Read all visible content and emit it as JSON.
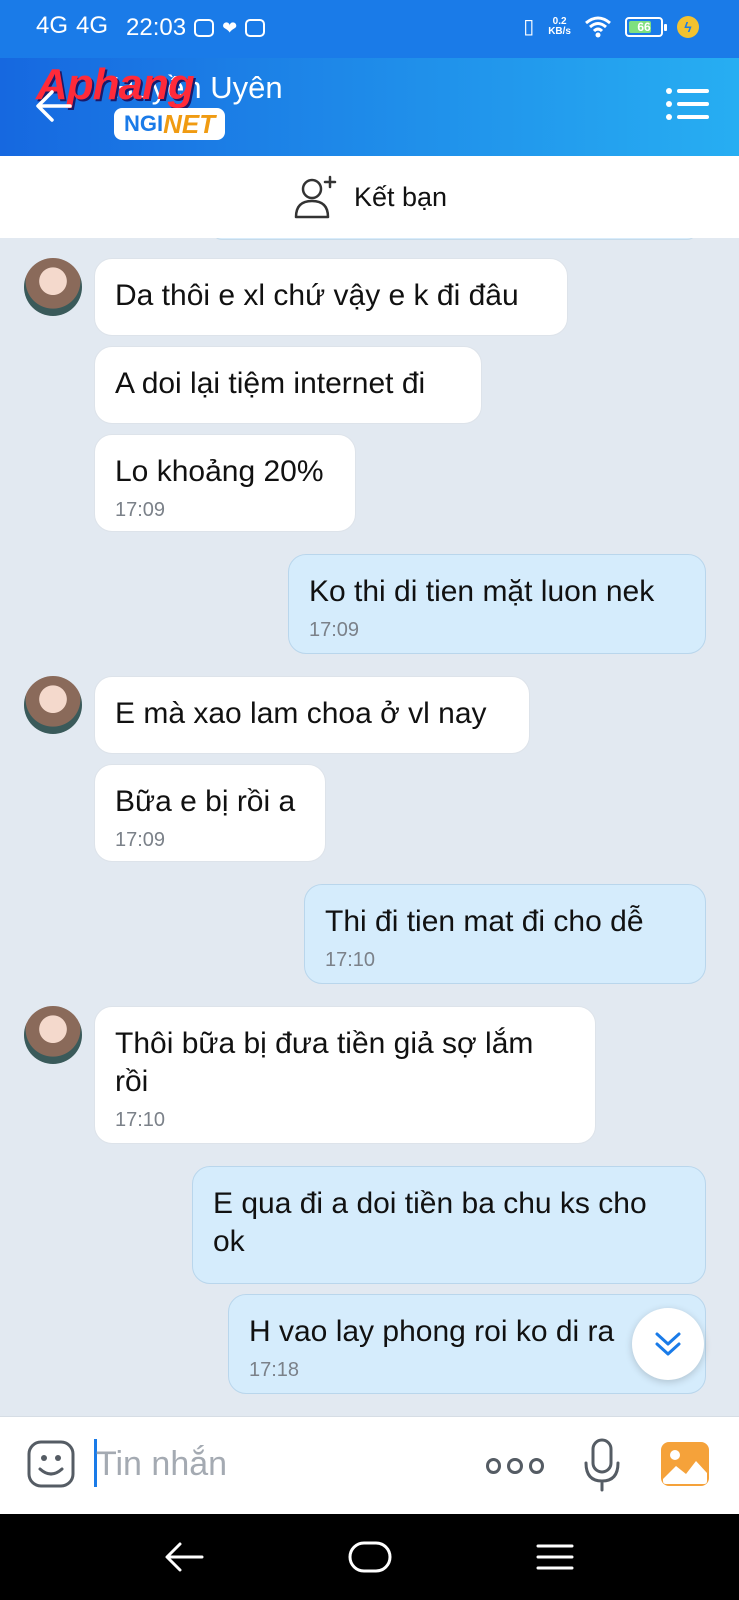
{
  "status_bar": {
    "network_1": "4G",
    "network_2": "4G",
    "time": "22:03",
    "speed_value": "0.2",
    "speed_unit": "KB/s",
    "battery": "66"
  },
  "header": {
    "contact_name": "Huyền Uyên",
    "watermark_text": "Aphang NGINET"
  },
  "friend_bar": {
    "label": "Kết bạn"
  },
  "messages": [
    {
      "text": "Da thôi e xl chứ vậy e k đi đâu",
      "time": ""
    },
    {
      "text": "A doi lại tiệm internet đi",
      "time": ""
    },
    {
      "text": "Lo khoảng 20%",
      "time": "17:09"
    },
    {
      "text": "Ko thi di tien mặt luon nek",
      "time": "17:09"
    },
    {
      "text": "E mà xao lam choa ở vl nay",
      "time": ""
    },
    {
      "text": "Bữa e bị rồi a",
      "time": "17:09"
    },
    {
      "text": "Thi đi tien mat đi cho dễ",
      "time": "17:10"
    },
    {
      "text": "Thôi bữa bị đưa tiền giả sợ lắm rồi",
      "time": "17:10"
    },
    {
      "text": "E qua đi a doi tiền ba chu ks cho ok",
      "time": ""
    },
    {
      "text": "H vao lay phong roi ko di ra",
      "time": "17:18"
    }
  ],
  "composer": {
    "placeholder": "Tin nhắn"
  },
  "icons": {
    "back": "arrow-left-icon",
    "menu": "list-menu-icon",
    "add_friend": "add-friend-icon",
    "scroll_down": "double-chevron-down-icon",
    "emoji": "emoji-icon",
    "more": "more-icon",
    "mic": "microphone-icon",
    "image": "image-icon"
  },
  "colors": {
    "header_start": "#1668e0",
    "header_end": "#27aef2",
    "chat_bg": "#e2e9f1",
    "incoming_bubble": "#ffffff",
    "outgoing_bubble": "#d5ecfc",
    "accent": "#1a7be8"
  }
}
